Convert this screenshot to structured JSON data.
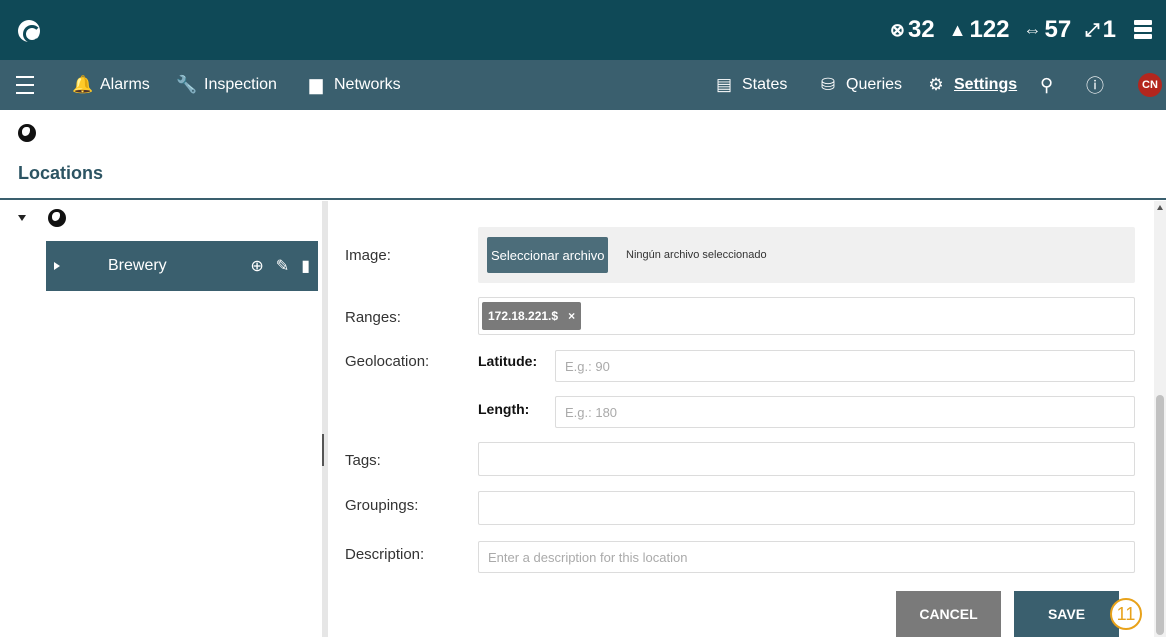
{
  "topbar": {
    "counters": [
      {
        "icon": "error-circle-icon",
        "glyph": "⊗",
        "value": "32"
      },
      {
        "icon": "warning-icon",
        "glyph": "▲",
        "value": "122"
      },
      {
        "icon": "link-icon",
        "glyph": "⇔",
        "value": "57"
      },
      {
        "icon": "broken-link-icon",
        "glyph": "⤢",
        "value": "1"
      }
    ]
  },
  "nav": {
    "left": [
      {
        "label": "Alarms",
        "icon": "bell-icon",
        "glyph": "🔔"
      },
      {
        "label": "Inspection",
        "icon": "wrench-icon",
        "glyph": "🔧"
      },
      {
        "label": "Networks",
        "icon": "monitor-icon",
        "glyph": "▆"
      }
    ],
    "right": [
      {
        "label": "States",
        "icon": "screen-icon",
        "glyph": "▤"
      },
      {
        "label": "Queries",
        "icon": "database-search-icon",
        "glyph": "⛁"
      },
      {
        "label": "Settings",
        "icon": "gear-icon",
        "glyph": "⚙"
      }
    ],
    "avatar": "CN"
  },
  "page": {
    "title": "Locations"
  },
  "tree": {
    "node_label": "Brewery"
  },
  "form": {
    "image_label": "Image:",
    "file_button": "Seleccionar archivo",
    "file_status": "Ningún archivo seleccionado",
    "ranges_label": "Ranges:",
    "range_chip": "172.18.221.$",
    "geolocation_label": "Geolocation:",
    "latitude_label": "Latitude:",
    "latitude_placeholder": "E.g.: 90",
    "length_label": "Length:",
    "length_placeholder": "E.g.: 180",
    "tags_label": "Tags:",
    "groupings_label": "Groupings:",
    "description_label": "Description:",
    "description_placeholder": "Enter a description for this location",
    "cancel": "CANCEL",
    "save": "SAVE",
    "step_marker": "11"
  },
  "colors": {
    "topbar": "#0f4957",
    "navbar": "#3a5f6e",
    "avatar": "#b3261e",
    "marker": "#e8a21a"
  }
}
